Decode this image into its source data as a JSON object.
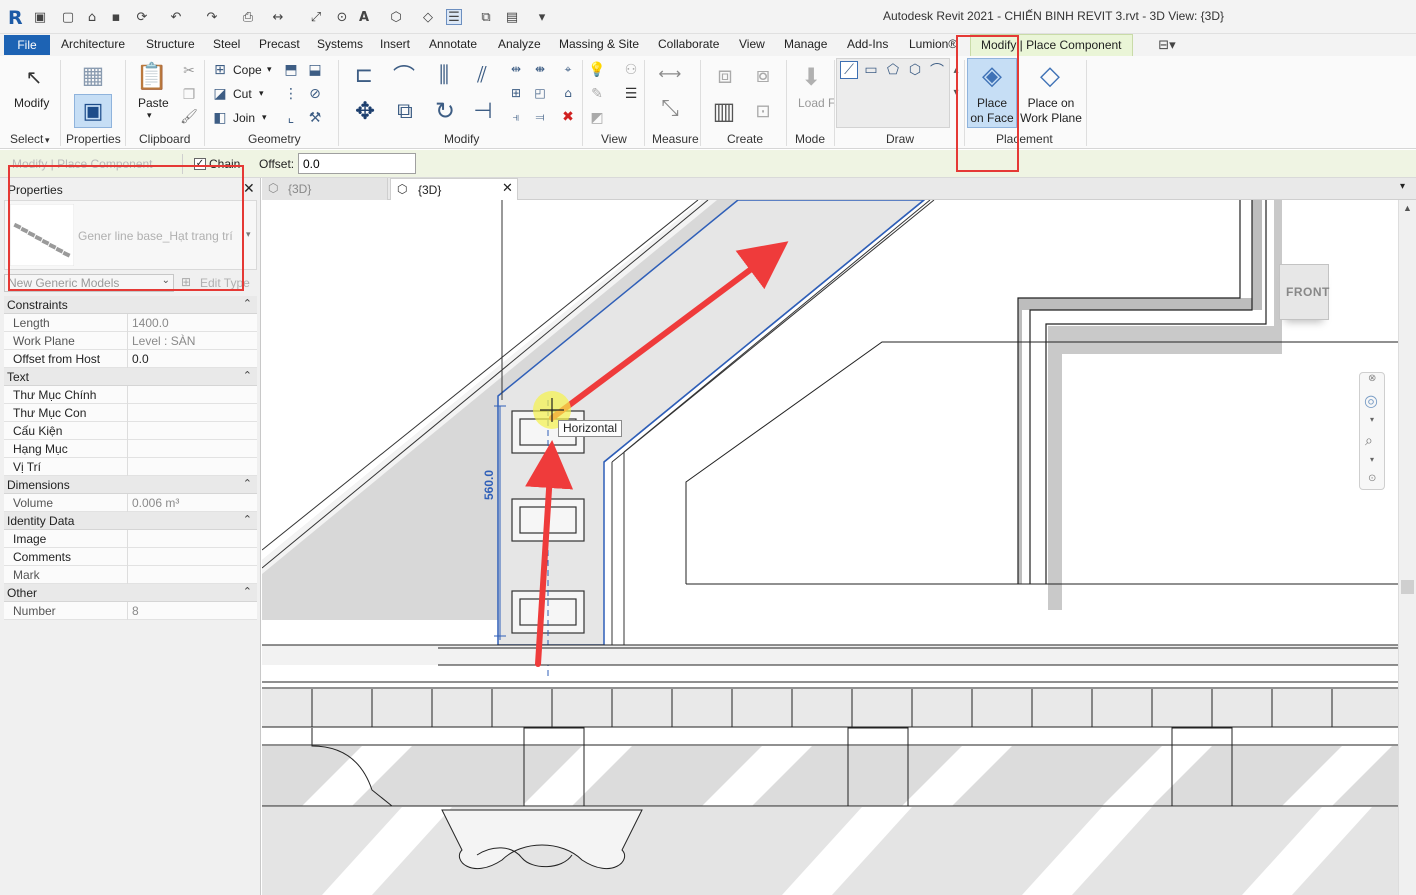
{
  "app": {
    "logo": "R",
    "window_title": "Autodesk Revit 2021 - CHIẾN BINH REVIT 3.rvt - 3D View: {3D}"
  },
  "menu": {
    "file": "File",
    "tabs": [
      "Architecture",
      "Structure",
      "Steel",
      "Precast",
      "Systems",
      "Insert",
      "Annotate",
      "Analyze",
      "Massing & Site",
      "Collaborate",
      "View",
      "Manage",
      "Add-Ins",
      "Lumion®"
    ],
    "contextual_tab": "Modify | Place Component"
  },
  "ribbon": {
    "modify": "Modify",
    "properties": "Properties",
    "paste": "Paste",
    "cope": "Cope",
    "cut": "Cut",
    "join": "Join",
    "load_family": "Load Family",
    "place_on_face": "Place on Face",
    "place_on_work_plane": "Place on Work Plane",
    "panels": {
      "select": "Select",
      "properties": "Properties",
      "clipboard": "Clipboard",
      "geometry": "Geometry",
      "modify": "Modify",
      "view": "View",
      "measure": "Measure",
      "create": "Create",
      "mode": "Mode",
      "draw": "Draw",
      "placement": "Placement"
    }
  },
  "options_bar": {
    "context": "Modify | Place Component",
    "chain": "Chain",
    "offset_label": "Offset:",
    "offset_value": "0.0"
  },
  "properties_panel": {
    "title": "Properties",
    "family_name": "Gener line base_Hạt trang trí",
    "type_selector": "New Generic Models",
    "edit_type": "Edit Type",
    "groups": [
      {
        "label": "Constraints",
        "rows": [
          {
            "key": "Length",
            "value": "1400.0"
          },
          {
            "key": "Work Plane",
            "value": "Level : SÀN"
          },
          {
            "key": "Offset from Host",
            "value": "0.0"
          }
        ]
      },
      {
        "label": "Text",
        "rows": [
          {
            "key": "Thư Mục Chính",
            "value": ""
          },
          {
            "key": "Thư Mục Con",
            "value": ""
          },
          {
            "key": "Cấu Kiện",
            "value": ""
          },
          {
            "key": "Hạng Mục",
            "value": ""
          },
          {
            "key": "Vị Trí",
            "value": ""
          }
        ]
      },
      {
        "label": "Dimensions",
        "rows": [
          {
            "key": "Volume",
            "value": "0.006 m³"
          }
        ]
      },
      {
        "label": "Identity Data",
        "rows": [
          {
            "key": "Image",
            "value": ""
          },
          {
            "key": "Comments",
            "value": ""
          },
          {
            "key": "Mark",
            "value": ""
          }
        ]
      },
      {
        "label": "Other",
        "rows": [
          {
            "key": "Number",
            "value": "8"
          }
        ]
      }
    ]
  },
  "view_tabs": [
    {
      "label": "{3D}"
    },
    {
      "label": "{3D}"
    }
  ],
  "viewport": {
    "tooltip": "Horizontal",
    "dimension": "560.0",
    "viewcube": "FRONT"
  },
  "colors": {
    "accent": "#1d63b4",
    "highlight_box": "#e53935",
    "contextual_tab": "#eaf5d7",
    "selection_blue": "#2f5fb8"
  }
}
